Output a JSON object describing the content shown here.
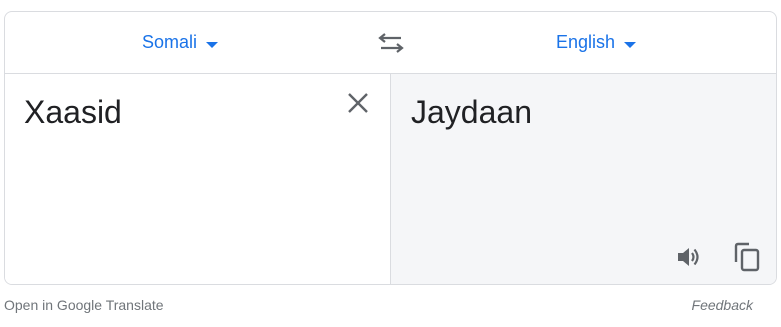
{
  "languages": {
    "source": "Somali",
    "target": "English"
  },
  "source": {
    "text": "Xaasid"
  },
  "translation": {
    "text": "Jaydaan"
  },
  "footer": {
    "open_link": "Open in Google Translate",
    "feedback": "Feedback"
  },
  "icons": {
    "swap": "swap-arrows-icon",
    "clear": "close-icon",
    "listen": "speaker-icon",
    "copy": "copy-icon",
    "dropdown": "caret-down-icon"
  },
  "colors": {
    "accent": "#1a73e8",
    "text": "#202124",
    "muted": "#70757a",
    "icon": "#5f6368",
    "border": "#dadce0",
    "target_bg": "#f5f6f8"
  }
}
